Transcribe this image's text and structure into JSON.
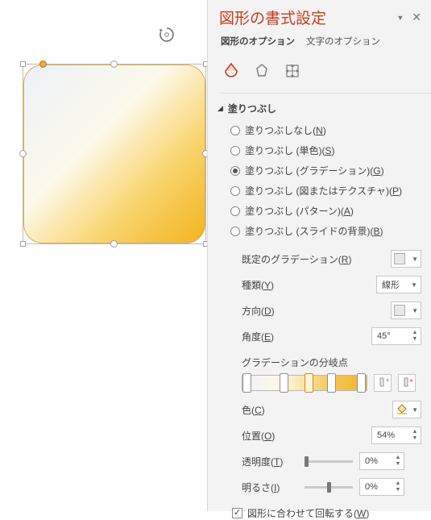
{
  "pane": {
    "title": "図形の書式設定",
    "tabs": {
      "shape_options": "図形のオプション",
      "text_options": "文字のオプション"
    },
    "section_fill": "塗りつぶし",
    "fill_options": {
      "none": {
        "label_pre": "塗りつぶしなし(",
        "key": "N",
        "label_post": ")"
      },
      "solid": {
        "label_pre": "塗りつぶし (単色)(",
        "key": "S",
        "label_post": ")"
      },
      "gradient": {
        "label_pre": "塗りつぶし (グラデーション)(",
        "key": "G",
        "label_post": ")"
      },
      "picture": {
        "label_pre": "塗りつぶし (図またはテクスチャ)(",
        "key": "P",
        "label_post": ")"
      },
      "pattern": {
        "label_pre": "塗りつぶし (パターン)(",
        "key": "A",
        "label_post": ")"
      },
      "slidebg": {
        "label_pre": "塗りつぶし (スライドの背景)(",
        "key": "B",
        "label_post": ")"
      }
    },
    "props": {
      "preset": {
        "label_pre": "既定のグラデーション(",
        "key": "R",
        "label_post": ")"
      },
      "type": {
        "label_pre": "種類(",
        "key": "Y",
        "label_post": ")",
        "value": "線形"
      },
      "direction": {
        "label_pre": "方向(",
        "key": "D",
        "label_post": ")"
      },
      "angle": {
        "label_pre": "角度(",
        "key": "E",
        "label_post": ")",
        "value": "45°"
      },
      "stops_label": "グラデーションの分岐点",
      "color": {
        "label_pre": "色(",
        "key": "C",
        "label_post": ")"
      },
      "position": {
        "label_pre": "位置(",
        "key": "O",
        "label_post": ")",
        "value": "54%"
      },
      "transparency": {
        "label_pre": "透明度(",
        "key": "T",
        "label_post": ")",
        "value": "0%"
      },
      "brightness": {
        "label_pre": "明るさ(",
        "key": "I",
        "label_post": ")",
        "value": "0%"
      },
      "rotate_with_shape": {
        "label_pre": "図形に合わせて回転する(",
        "key": "W",
        "label_post": ")"
      }
    }
  }
}
